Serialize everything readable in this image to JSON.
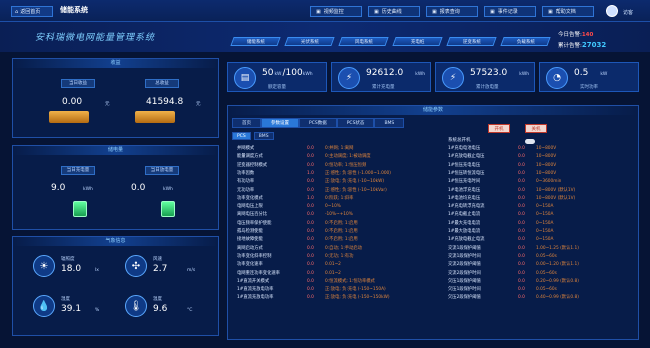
{
  "header": {
    "back_label": "返回首页",
    "system_name": "储能系统",
    "user_name": "访客",
    "buttons": [
      {
        "label": "视频监控",
        "icon": "video-icon"
      },
      {
        "label": "历史曲线",
        "icon": "chart-icon"
      },
      {
        "label": "报表查询",
        "icon": "report-icon"
      },
      {
        "label": "事件记录",
        "icon": "event-icon"
      },
      {
        "label": "帮助文档",
        "icon": "help-icon"
      }
    ]
  },
  "banner": {
    "title": "安科瑞微电网能量管理系统",
    "tabs": [
      "储能系统",
      "光伏系统",
      "风电系统",
      "充电桩",
      "逆变系统",
      "负载系统"
    ],
    "alarm_label": "今日告警:",
    "alarm_value": "140",
    "total_label": "累计告警:",
    "total_value": "27032"
  },
  "revenue": {
    "title": "收益",
    "today_label": "当日收益",
    "total_label": "总收益",
    "today_value": "0.00",
    "total_value": "41594.8",
    "unit": "元"
  },
  "storage": {
    "title": "储电量",
    "charge_label": "当日充电量",
    "discharge_label": "当日放电量",
    "charge_value": "9.0",
    "discharge_value": "0.0",
    "unit": "kWh"
  },
  "weather": {
    "title": "气象信息",
    "items": [
      {
        "label": "辐照度",
        "value": "18.0",
        "unit": "lx",
        "icon": "sun-icon"
      },
      {
        "label": "风速",
        "value": "2.7",
        "unit": "m/s",
        "icon": "fan-icon"
      },
      {
        "label": "湿度",
        "value": "39.1",
        "unit": "%",
        "icon": "humidity-icon"
      },
      {
        "label": "温度",
        "value": "9.6",
        "unit": "°C",
        "icon": "temperature-icon"
      }
    ]
  },
  "stats": [
    {
      "value": "50",
      "value2": "/100",
      "unit": "kW",
      "unit2": "kWh",
      "label": "额定容量",
      "icon": "battery-icon"
    },
    {
      "value": "92612.0",
      "unit": "kWh",
      "label": "累计充电量",
      "icon": "charge-icon"
    },
    {
      "value": "57523.0",
      "unit": "kWh",
      "label": "累计放电量",
      "icon": "discharge-icon"
    },
    {
      "value": "0.5",
      "unit": "kW",
      "label": "实时功率",
      "icon": "gauge-icon"
    }
  ],
  "params": {
    "title": "储能参数",
    "tabs": [
      "首页",
      "参数设置",
      "PCS数据",
      "PCS状态",
      "BMS"
    ],
    "subtabs": [
      "PCS",
      "BMS"
    ],
    "on_label": "开机",
    "off_label": "关机",
    "system_onoff": "系统总开机",
    "left": [
      {
        "label": "并网模式",
        "val": "0.0",
        "rng": "0:并网; 1:离网"
      },
      {
        "label": "能量调度方式",
        "val": "0.0",
        "rng": "0:主动调度; 1:被动调度"
      },
      {
        "label": "逆变器控制模式",
        "val": "0.0",
        "rng": "0:恒功率; 1:恒压恒频"
      },
      {
        "label": "功率因数",
        "val": "1.0",
        "rng": "正:感性; 负:容性 (-1.000~1.000)"
      },
      {
        "label": "有功功率",
        "val": "0.0",
        "rng": "正:放电; 负:充电 (-10~10kW)"
      },
      {
        "label": "无功功率",
        "val": "0.0",
        "rng": "正:感性; 负:容性 (-10~10kVar)"
      },
      {
        "label": "功率变化模式",
        "val": "1.0",
        "rng": "0:阶跃; 1:斜率"
      },
      {
        "label": "电网电压上限",
        "val": "0.0",
        "rng": "0~10%"
      },
      {
        "label": "离网电压百分比",
        "val": "0.0",
        "rng": "-10%~+10%"
      },
      {
        "label": "电压频率保护使能",
        "val": "0.0",
        "rng": "0:不启用; 1:启用"
      },
      {
        "label": "孤岛检测使能",
        "val": "0.0",
        "rng": "0:不启用; 1:启用"
      },
      {
        "label": "接地故障使能",
        "val": "0.0",
        "rng": "0:不启用; 1:启用"
      },
      {
        "label": "离网启动方式",
        "val": "0.0",
        "rng": "0:自动; 1:手动启动"
      },
      {
        "label": "功率变化斜率控制",
        "val": "0.0",
        "rng": "0:无功; 1:有功"
      },
      {
        "label": "功率变化速率",
        "val": "0.0",
        "rng": "0.01~2"
      },
      {
        "label": "电网重连功率变化速率",
        "val": "0.0",
        "rng": "0.01~2"
      },
      {
        "label": "1#直流开关模式",
        "val": "0.0",
        "rng": "0:恒流模式; 1:恒功率模式"
      },
      {
        "label": "1#直流充放电功率",
        "val": "0.0",
        "rng": "正:放电; 负:充电 (-150~150A)"
      },
      {
        "label": "1#直流充放电功率",
        "val": "0.0",
        "rng": "正:放电; 负:充电 (-150~150kW)"
      }
    ],
    "right": [
      {
        "label": "1#充电电池电压",
        "val": "0.0",
        "rng": "10~800V"
      },
      {
        "label": "1#充放电截止电压",
        "val": "0.0",
        "rng": "10~800V"
      },
      {
        "label": "1#恒压充电电压",
        "val": "0.0",
        "rng": "10~800V"
      },
      {
        "label": "1#恒压转恒流电压",
        "val": "0.0",
        "rng": "10~800V"
      },
      {
        "label": "1#恒压充电时间",
        "val": "0.0",
        "rng": "0~3600min"
      },
      {
        "label": "1#电池浮充电压",
        "val": "0.0",
        "rng": "10~800V (默认1V)"
      },
      {
        "label": "1#电池均充电压",
        "val": "0.0",
        "rng": "10~800V (默认1V)"
      },
      {
        "label": "1#充电转浮充电流",
        "val": "0.0",
        "rng": "0~150A"
      },
      {
        "label": "1#充电截止电流",
        "val": "0.0",
        "rng": "0~150A"
      },
      {
        "label": "1#最大充电电流",
        "val": "0.0",
        "rng": "0~150A"
      },
      {
        "label": "1#最大放电电流",
        "val": "0.0",
        "rng": "0~150A"
      },
      {
        "label": "1#充放电截止电流",
        "val": "0.0",
        "rng": "0~150A"
      },
      {
        "label": "交流1段保护阈值",
        "val": "0.0",
        "rng": "1.00~1.25 (默认1.1)"
      },
      {
        "label": "交流1段保护时间",
        "val": "0.0",
        "rng": "0.05~60s"
      },
      {
        "label": "交流2段保护阈值",
        "val": "0.0",
        "rng": "0.00~1.20 (默认1.1)"
      },
      {
        "label": "交流2段保护时间",
        "val": "0.0",
        "rng": "0.05~60s"
      },
      {
        "label": "欠压1段保护阈值",
        "val": "0.0",
        "rng": "0.20~0.99 (默认0.8)"
      },
      {
        "label": "欠压1段保护时间",
        "val": "0.0",
        "rng": "0.05~60s"
      },
      {
        "label": "欠压2段保护阈值",
        "val": "0.0",
        "rng": "0.40~0.99 (默认0.8)"
      }
    ]
  }
}
